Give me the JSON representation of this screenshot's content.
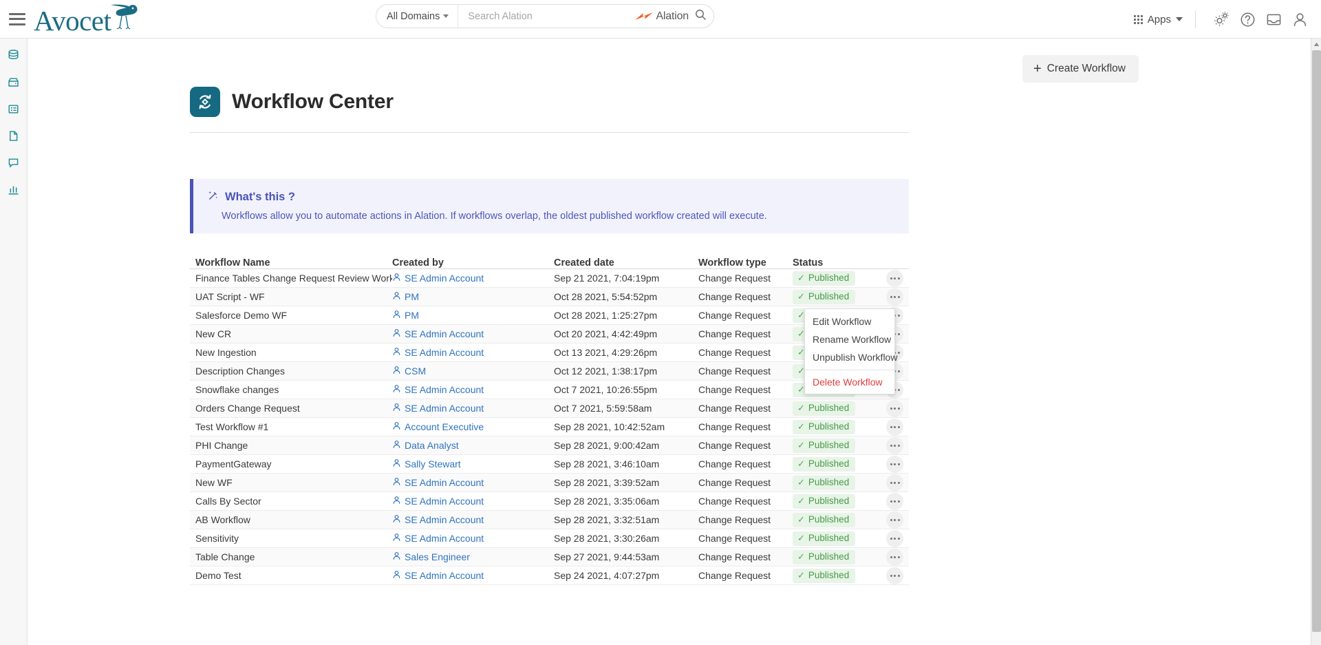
{
  "topbar": {
    "menu_icon": "hamburger-icon",
    "brand": "Avocet",
    "search": {
      "domain_label": "All Domains",
      "placeholder": "Search Alation",
      "value": "",
      "logo_text": "Alation",
      "search_icon": "magnifier-icon"
    },
    "apps_label": "Apps",
    "icons": [
      "gears-icon",
      "help-circle-icon",
      "inbox-icon",
      "user-icon"
    ]
  },
  "sidebar": {
    "items": [
      {
        "name": "database-icon",
        "label": "Data Sources"
      },
      {
        "name": "archive-icon",
        "label": "Catalog Sets"
      },
      {
        "name": "grid-icon",
        "label": "Queries"
      },
      {
        "name": "document-icon",
        "label": "Articles"
      },
      {
        "name": "conversation-icon",
        "label": "Conversations"
      },
      {
        "name": "bar-chart-icon",
        "label": "Analytics"
      }
    ]
  },
  "toolbar": {
    "create_label": "Create Workflow",
    "plus": "+"
  },
  "page": {
    "title": "Workflow Center",
    "icon": "workflow-refresh-icon"
  },
  "info": {
    "wand_icon": "magic-wand-icon",
    "title": "What's this ?",
    "body": "Workflows allow you to automate actions in Alation. If workflows overlap, the oldest published workflow created will execute.",
    "accent": "#4a52b8",
    "background": "#f1f2fb"
  },
  "table": {
    "columns": [
      "Workflow Name",
      "Created by",
      "Created date",
      "Workflow type",
      "Status"
    ],
    "status_badge": {
      "label": "Published",
      "color": "#4a9a4a",
      "background": "#e7f4e7",
      "icon": "check-icon"
    },
    "row_menu_icon": "kebab-menu-icon",
    "rows": [
      {
        "name": "Finance Tables Change Request Review Workflow",
        "created_by": "SE Admin Account",
        "created_date": "Sep 21 2021, 7:04:19pm",
        "type": "Change Request",
        "status": "Published"
      },
      {
        "name": "UAT Script - WF",
        "created_by": "PM",
        "created_date": "Oct 28 2021, 5:54:52pm",
        "type": "Change Request",
        "status": "Published"
      },
      {
        "name": "Salesforce Demo WF",
        "created_by": "PM",
        "created_date": "Oct 28 2021, 1:25:27pm",
        "type": "Change Request",
        "status": "Published"
      },
      {
        "name": "New CR",
        "created_by": "SE Admin Account",
        "created_date": "Oct 20 2021, 4:42:49pm",
        "type": "Change Request",
        "status": "Published"
      },
      {
        "name": "New Ingestion",
        "created_by": "SE Admin Account",
        "created_date": "Oct 13 2021, 4:29:26pm",
        "type": "Change Request",
        "status": "Published"
      },
      {
        "name": "Description Changes",
        "created_by": "CSM",
        "created_date": "Oct 12 2021, 1:38:17pm",
        "type": "Change Request",
        "status": "Published"
      },
      {
        "name": "Snowflake changes",
        "created_by": "SE Admin Account",
        "created_date": "Oct 7 2021, 10:26:55pm",
        "type": "Change Request",
        "status": "Published"
      },
      {
        "name": "Orders Change Request",
        "created_by": "SE Admin Account",
        "created_date": "Oct 7 2021, 5:59:58am",
        "type": "Change Request",
        "status": "Published"
      },
      {
        "name": "Test Workflow #1",
        "created_by": "Account Executive",
        "created_date": "Sep 28 2021, 10:42:52am",
        "type": "Change Request",
        "status": "Published"
      },
      {
        "name": "PHI Change",
        "created_by": "Data Analyst",
        "created_date": "Sep 28 2021, 9:00:42am",
        "type": "Change Request",
        "status": "Published"
      },
      {
        "name": "PaymentGateway",
        "created_by": "Sally Stewart",
        "created_date": "Sep 28 2021, 3:46:10am",
        "type": "Change Request",
        "status": "Published"
      },
      {
        "name": "New WF",
        "created_by": "SE Admin Account",
        "created_date": "Sep 28 2021, 3:39:52am",
        "type": "Change Request",
        "status": "Published"
      },
      {
        "name": "Calls By Sector",
        "created_by": "SE Admin Account",
        "created_date": "Sep 28 2021, 3:35:06am",
        "type": "Change Request",
        "status": "Published"
      },
      {
        "name": "AB Workflow",
        "created_by": "SE Admin Account",
        "created_date": "Sep 28 2021, 3:32:51am",
        "type": "Change Request",
        "status": "Published"
      },
      {
        "name": "Sensitivity",
        "created_by": "SE Admin Account",
        "created_date": "Sep 28 2021, 3:30:26am",
        "type": "Change Request",
        "status": "Published"
      },
      {
        "name": "Table Change",
        "created_by": "Sales Engineer",
        "created_date": "Sep 27 2021, 9:44:53am",
        "type": "Change Request",
        "status": "Published"
      },
      {
        "name": "Demo Test",
        "created_by": "SE Admin Account",
        "created_date": "Sep 24 2021, 4:07:27pm",
        "type": "Change Request",
        "status": "Published"
      }
    ]
  },
  "row_menu": {
    "items": [
      {
        "label": "Edit Workflow",
        "danger": false
      },
      {
        "label": "Rename Workflow",
        "danger": false
      },
      {
        "label": "Unpublish Workflow",
        "danger": false
      },
      {
        "label": "Delete Workflow",
        "danger": true
      }
    ]
  }
}
